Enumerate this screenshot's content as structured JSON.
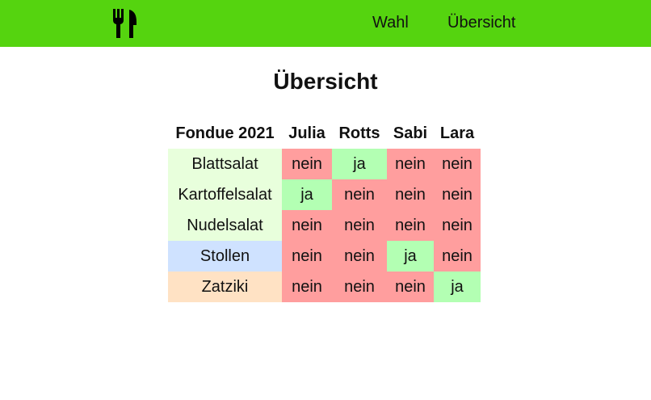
{
  "nav": {
    "logo_icon": "fork-knife-icon",
    "links": [
      {
        "label": "Wahl"
      },
      {
        "label": "Übersicht"
      }
    ],
    "background": "#55d40f"
  },
  "page": {
    "title": "Übersicht"
  },
  "table": {
    "corner_header": "Fondue 2021",
    "people": [
      "Julia",
      "Rotts",
      "Sabi",
      "Lara"
    ],
    "colors": {
      "ja": "#b3ffb3",
      "nein": "#ff9e9e",
      "salat": "#e8ffdc",
      "stollen": "#cfe2ff",
      "zatziki": "#ffe2c4"
    },
    "rows": [
      {
        "dish": "Blattsalat",
        "dish_color": "#e8ffdc",
        "votes": [
          "nein",
          "ja",
          "nein",
          "nein"
        ]
      },
      {
        "dish": "Kartoffelsalat",
        "dish_color": "#e8ffdc",
        "votes": [
          "ja",
          "nein",
          "nein",
          "nein"
        ]
      },
      {
        "dish": "Nudelsalat",
        "dish_color": "#e8ffdc",
        "votes": [
          "nein",
          "nein",
          "nein",
          "nein"
        ]
      },
      {
        "dish": "Stollen",
        "dish_color": "#cfe2ff",
        "votes": [
          "nein",
          "nein",
          "ja",
          "nein"
        ]
      },
      {
        "dish": "Zatziki",
        "dish_color": "#ffe2c4",
        "votes": [
          "nein",
          "nein",
          "nein",
          "ja"
        ]
      }
    ]
  }
}
